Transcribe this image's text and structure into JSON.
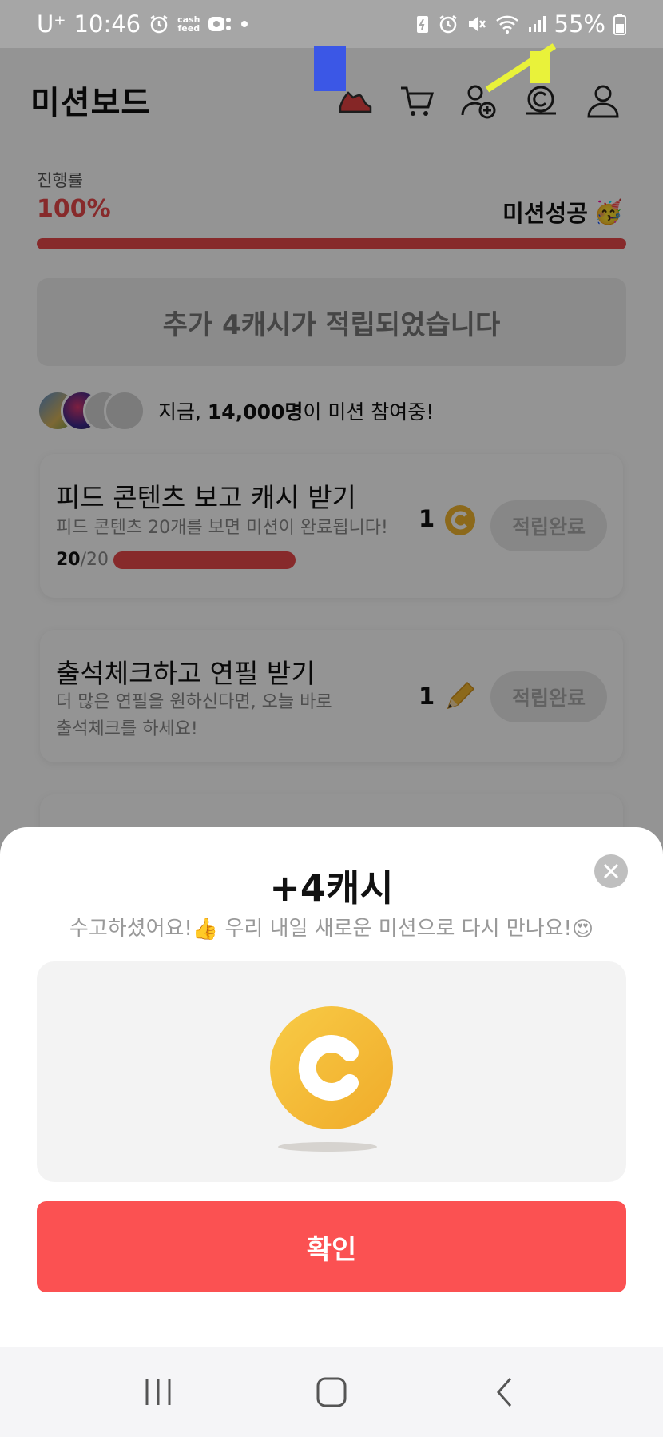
{
  "status_bar": {
    "carrier": "U⁺",
    "time": "10:46",
    "cashfeed_line1": "cash",
    "cashfeed_line2": "feed",
    "battery": "55%"
  },
  "header": {
    "title": "미션보드"
  },
  "progress": {
    "label": "진행률",
    "value": "100%",
    "fraction": 1.0,
    "status": "미션성공",
    "status_emoji": "🥳"
  },
  "bonus": {
    "text": "추가 4캐시가 적립되었습니다"
  },
  "participants": {
    "prefix": "지금, ",
    "count": "14,000명",
    "suffix": "이 미션 참여중!"
  },
  "missions": [
    {
      "title": "피드 콘텐츠 보고 캐시 받기",
      "desc": "피드 콘텐츠 20개를 보면 미션이 완료됩니다!",
      "reward_count": "1",
      "reward_icon": "coin-icon",
      "button": "적립완료",
      "progress_current": "20",
      "progress_total": "/20",
      "progress_fraction": 1.0
    },
    {
      "title": "출석체크하고 연필 받기",
      "desc_line1": "더 많은 연필을 원하신다면, 오늘 바로",
      "desc_line2": "출석체크를 하세요!",
      "reward_count": "1",
      "reward_icon": "pencil-icon",
      "button": "적립완료"
    }
  ],
  "sheet": {
    "title": "+4캐시",
    "message_part1": "수고하셨어요!",
    "message_emoji1": "👍",
    "message_part2": " 우리 내일 새로운 미션으로 다시 만나요!",
    "message_emoji2": "😍",
    "confirm": "확인"
  },
  "colors": {
    "accent_red": "#e9494a",
    "confirm_red": "#fb5152",
    "coin_yellow": "#f2b630"
  }
}
